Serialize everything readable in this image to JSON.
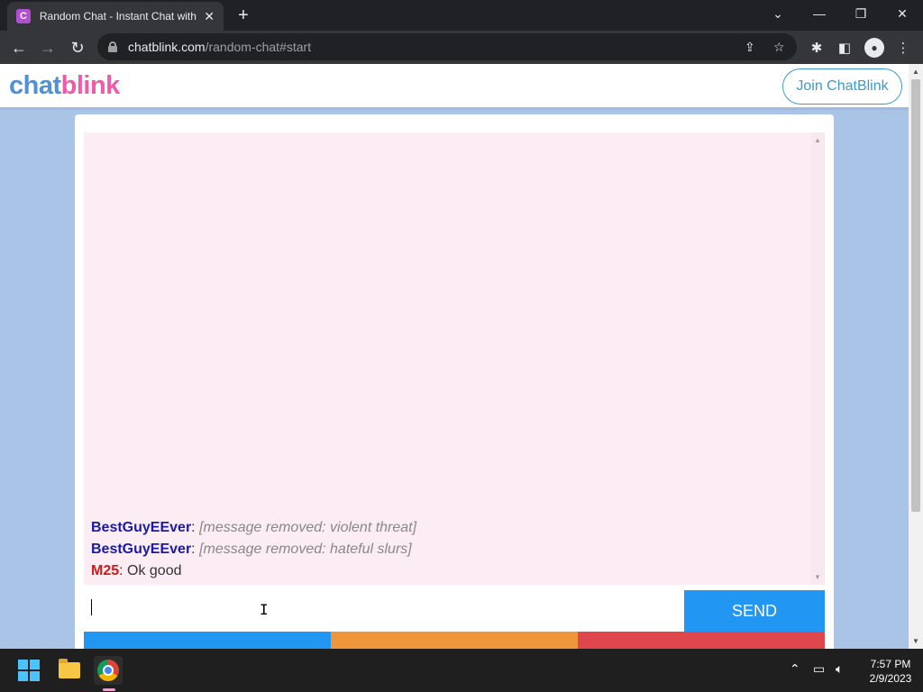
{
  "browser": {
    "tab_title": "Random Chat - Instant Chat with",
    "tab_favicon": "C",
    "tab_close": "✕",
    "new_tab": "+",
    "url_host": "chatblink.com",
    "url_path": "/random-chat#start"
  },
  "site": {
    "logo_chat": "chat",
    "logo_blink": "blink",
    "join_label": "Join ChatBlink"
  },
  "chat": {
    "messages": [
      {
        "user": "BestGuyEEver",
        "color": "#1a1aa6",
        "text": "[message removed: violent threat]"
      },
      {
        "user": "BestGuyEEver",
        "color": "#1a1aa6",
        "text": "[message removed: hateful slurs]"
      },
      {
        "user": "M25",
        "color": "#d11a1a",
        "text": "Ok good"
      }
    ],
    "input_value": "",
    "send_label": "SEND"
  },
  "taskbar": {
    "time": "7:57 PM",
    "date": "2/9/2023"
  }
}
